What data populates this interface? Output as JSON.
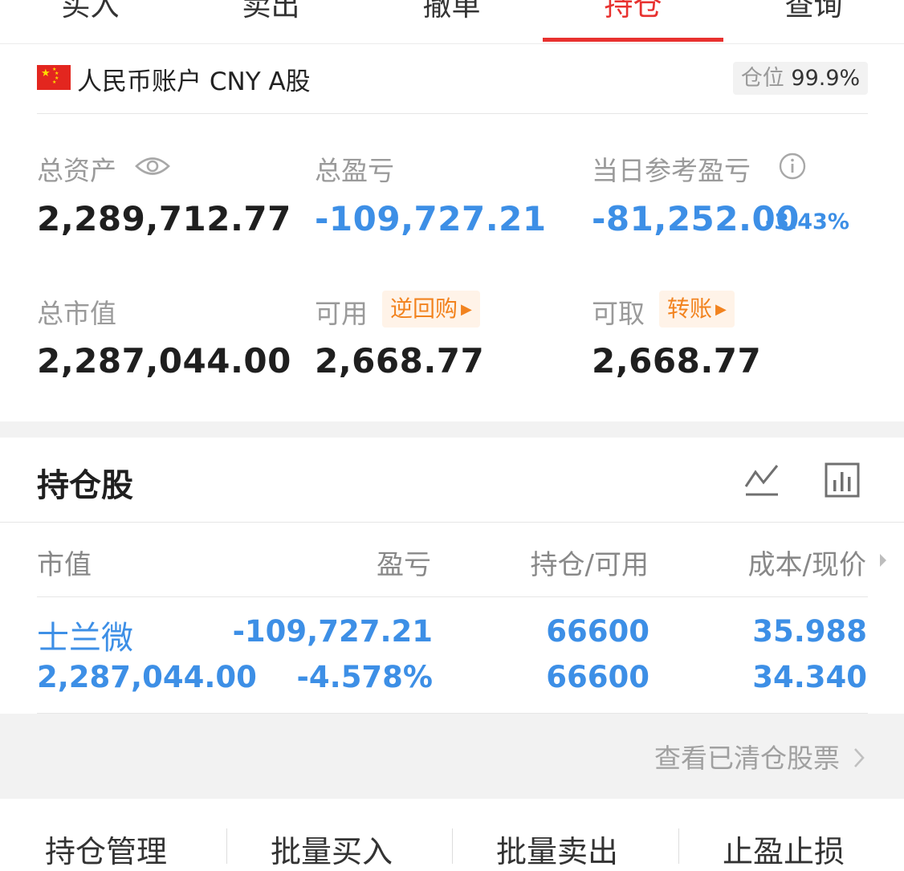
{
  "tabs": [
    {
      "label": "买入"
    },
    {
      "label": "卖出"
    },
    {
      "label": "撤单"
    },
    {
      "label": "持仓"
    },
    {
      "label": "查询"
    }
  ],
  "account": {
    "title": "人民币账户 CNY A股",
    "position_label": "仓位",
    "position_value": "99.9%"
  },
  "summary": {
    "total_assets_label": "总资产",
    "total_assets": "2,289,712.77",
    "total_pnl_label": "总盈亏",
    "total_pnl": "-109,727.21",
    "today_pnl_label": "当日参考盈亏",
    "today_pnl": "-81,252.00",
    "today_pnl_pct": "-3.43%",
    "market_value_label": "总市值",
    "market_value": "2,287,044.00",
    "available_label": "可用",
    "available_chip": "逆回购",
    "available": "2,668.77",
    "withdrawable_label": "可取",
    "withdrawable_chip": "转账",
    "withdrawable": "2,668.77"
  },
  "holdings": {
    "title": "持仓股",
    "columns": [
      "市值",
      "盈亏",
      "持仓/可用",
      "成本/现价"
    ],
    "rows": [
      {
        "name": "士兰微",
        "market_value": "2,287,044.00",
        "pnl": "-109,727.21",
        "pnl_pct": "-4.578%",
        "position": "66600",
        "available": "66600",
        "cost": "35.988",
        "price": "34.340"
      }
    ],
    "cleared_link": "查看已清仓股票"
  },
  "bottom_bar": {
    "items": [
      "持仓管理",
      "批量买入",
      "批量卖出",
      "止盈止损"
    ]
  },
  "colors": {
    "accent_red": "#e8312f",
    "loss_blue": "#3d8fe6",
    "chip_orange": "#f2831f"
  }
}
